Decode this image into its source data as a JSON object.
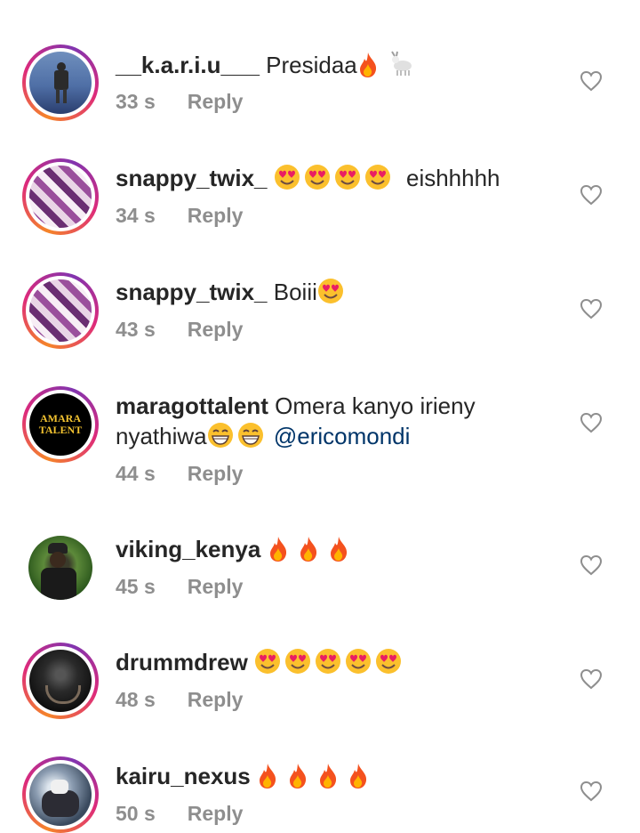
{
  "comments": [
    {
      "username": "__k.a.r.i.u___",
      "text": "Presidaa",
      "time": "33 s",
      "reply": "Reply",
      "emoji": [
        "fire",
        "goat"
      ]
    },
    {
      "username": "snappy_twix_",
      "text": "eishhhhh",
      "time": "34 s",
      "reply": "Reply",
      "emoji": [
        "heart-eyes",
        "heart-eyes",
        "heart-eyes",
        "heart-eyes"
      ]
    },
    {
      "username": "snappy_twix_",
      "text": "Boiii",
      "time": "43 s",
      "reply": "Reply",
      "emoji": [
        "heart-eyes"
      ]
    },
    {
      "username": "maragottalent",
      "text": "Omera kanyo irieny",
      "text2": "nyathiwa",
      "mention": "@ericomondi",
      "time": "44 s",
      "reply": "Reply",
      "emoji": [
        "grin",
        "grin"
      ],
      "avatar_logo": "AMARA TALENT"
    },
    {
      "username": "viking_kenya",
      "text": "",
      "time": "45 s",
      "reply": "Reply",
      "emoji": [
        "fire",
        "fire",
        "fire"
      ]
    },
    {
      "username": "drummdrew",
      "text": "",
      "time": "48 s",
      "reply": "Reply",
      "emoji": [
        "heart-eyes",
        "heart-eyes",
        "heart-eyes",
        "heart-eyes",
        "heart-eyes"
      ]
    },
    {
      "username": "kairu_nexus",
      "text": "",
      "time": "50 s",
      "reply": "Reply",
      "emoji": [
        "fire",
        "fire",
        "fire",
        "fire"
      ]
    }
  ],
  "colors": {
    "ring_start": "#f58529",
    "ring_mid": "#dd2a7b",
    "meta": "#8e8e8e",
    "mention": "#003569"
  },
  "icons": {
    "like": "heart-outline-icon"
  }
}
